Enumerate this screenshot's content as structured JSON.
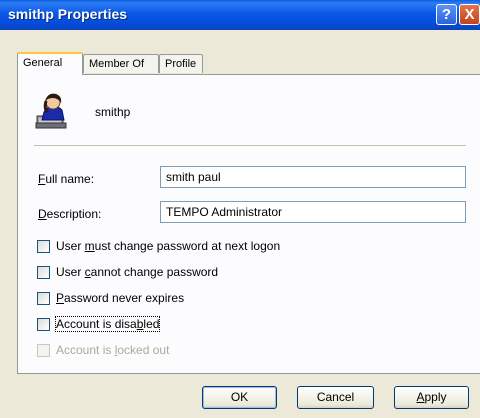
{
  "window": {
    "title": "smithp Properties",
    "help_glyph": "?",
    "close_glyph": "X"
  },
  "tabs": [
    {
      "label": "General",
      "active": true
    },
    {
      "label": "Member Of",
      "active": false
    },
    {
      "label": "Profile",
      "active": false
    }
  ],
  "user": {
    "icon": "user-icon",
    "name": "smithp"
  },
  "fields": {
    "full_name": {
      "label_prefix": "",
      "mnemonic": "F",
      "label_suffix": "ull name:",
      "value": "smith paul"
    },
    "description": {
      "label_prefix": "",
      "mnemonic": "D",
      "label_suffix": "escription:",
      "value": "TEMPO Administrator"
    }
  },
  "options": [
    {
      "pre": "User ",
      "mnemonic": "m",
      "post": "ust change password at next logon",
      "checked": false,
      "disabled": false
    },
    {
      "pre": "User ",
      "mnemonic": "c",
      "post": "annot change password",
      "checked": false,
      "disabled": false
    },
    {
      "pre": "",
      "mnemonic": "P",
      "post": "assword never expires",
      "checked": false,
      "disabled": false
    },
    {
      "pre": "Account is disa",
      "mnemonic": "b",
      "post": "led",
      "checked": false,
      "disabled": false
    },
    {
      "pre": "Account is ",
      "mnemonic": "l",
      "post": "ocked out",
      "checked": false,
      "disabled": true
    }
  ],
  "buttons": {
    "ok": "OK",
    "cancel": "Cancel",
    "apply_mnemonic": "A",
    "apply_rest": "pply"
  }
}
